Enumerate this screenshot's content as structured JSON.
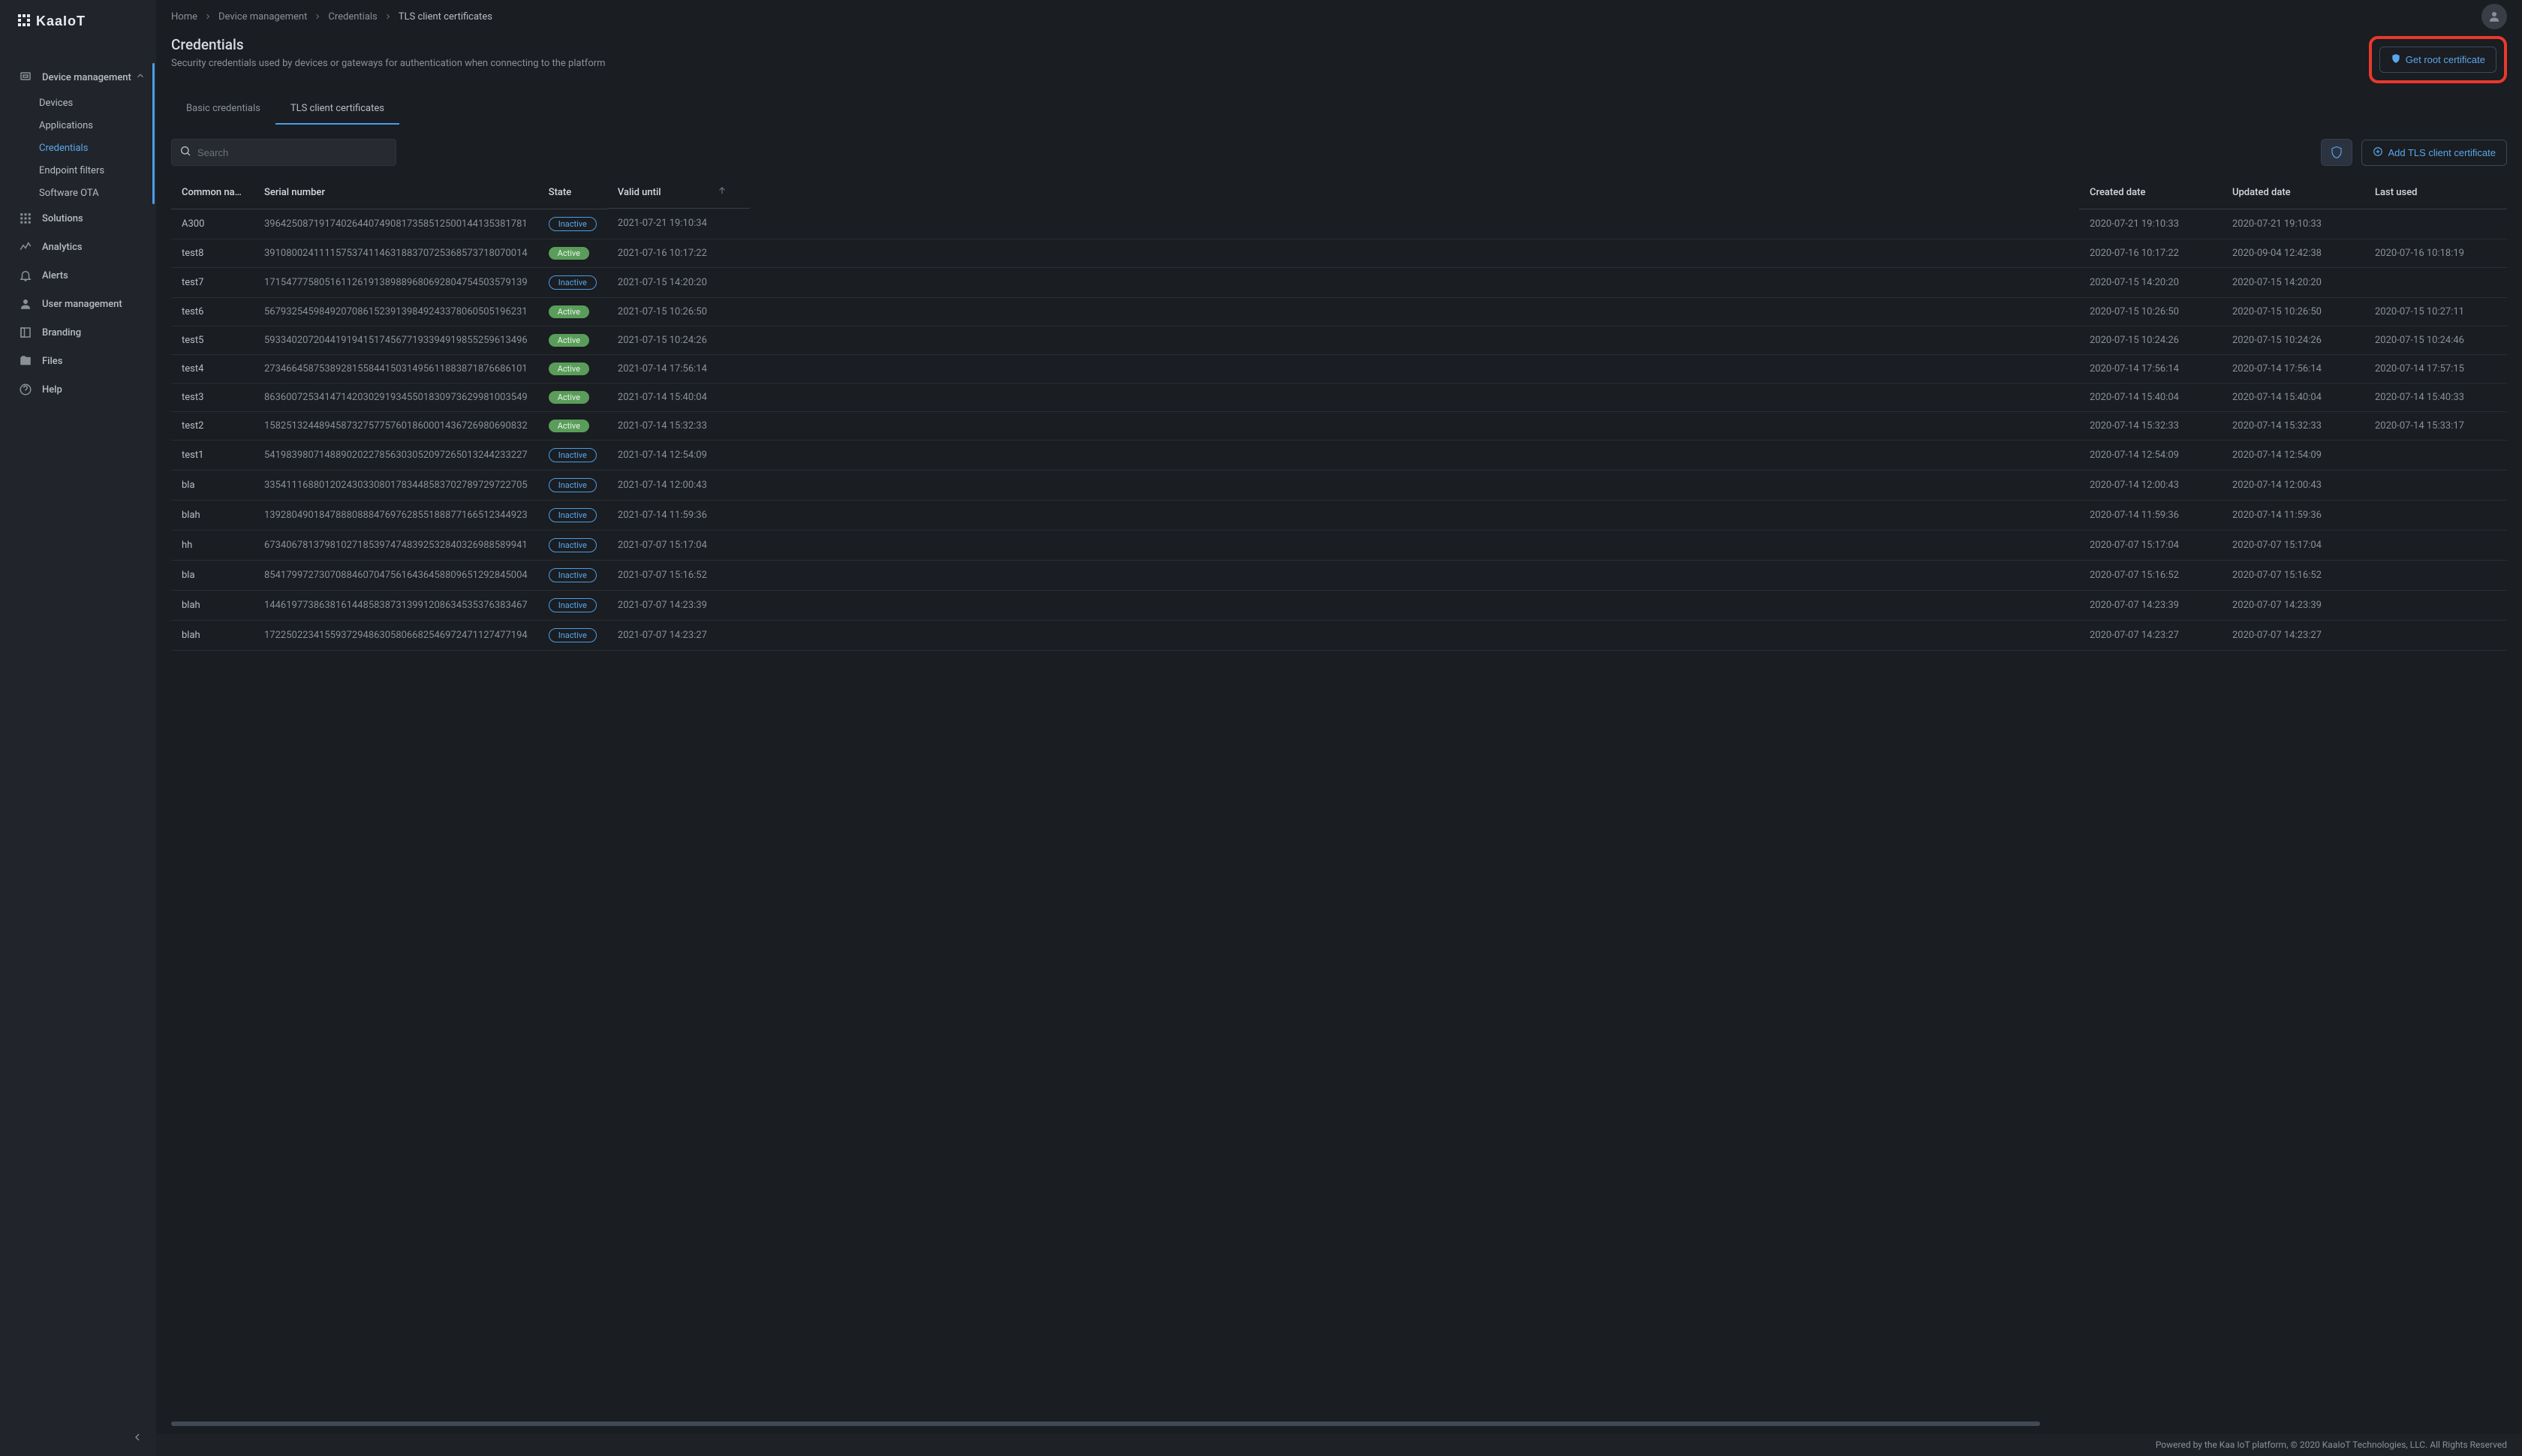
{
  "logo_text": "kaaIoT",
  "sidebar": {
    "items": [
      {
        "label": "Device management",
        "expanded": true,
        "children": [
          {
            "label": "Devices"
          },
          {
            "label": "Applications"
          },
          {
            "label": "Credentials",
            "active": true
          },
          {
            "label": "Endpoint filters"
          },
          {
            "label": "Software OTA"
          }
        ]
      },
      {
        "label": "Solutions"
      },
      {
        "label": "Analytics"
      },
      {
        "label": "Alerts"
      },
      {
        "label": "User management"
      },
      {
        "label": "Branding"
      },
      {
        "label": "Files"
      },
      {
        "label": "Help"
      }
    ]
  },
  "breadcrumb": [
    "Home",
    "Device management",
    "Credentials",
    "TLS client certificates"
  ],
  "page": {
    "title": "Credentials",
    "subtitle": "Security credentials used by devices or gateways for authentication when connecting to the platform",
    "get_root_label": "Get root certificate"
  },
  "tabs": {
    "basic": "Basic credentials",
    "tls": "TLS client certificates",
    "active": "tls"
  },
  "search": {
    "placeholder": "Search"
  },
  "toolbar": {
    "add_tls_label": "Add TLS client certificate"
  },
  "columns": {
    "common_name": "Common na…",
    "serial": "Serial number",
    "state": "State",
    "valid": "Valid until",
    "created": "Created date",
    "updated": "Updated date",
    "last_used": "Last used"
  },
  "rows": [
    {
      "common": "A300",
      "serial": "396425087191740264407490817358512500144135381781",
      "state": "Inactive",
      "valid": "2021-07-21 19:10:34",
      "created": "2020-07-21 19:10:33",
      "updated": "2020-07-21 19:10:33",
      "last": ""
    },
    {
      "common": "test8",
      "serial": "391080024111157537411463188370725368573718070014",
      "state": "Active",
      "valid": "2021-07-16 10:17:22",
      "created": "2020-07-16 10:17:22",
      "updated": "2020-09-04 12:42:38",
      "last": "2020-07-16 10:18:19"
    },
    {
      "common": "test7",
      "serial": "171547775805161126191389889680692804754503579139",
      "state": "Inactive",
      "valid": "2021-07-15 14:20:20",
      "created": "2020-07-15 14:20:20",
      "updated": "2020-07-15 14:20:20",
      "last": ""
    },
    {
      "common": "test6",
      "serial": "567932545984920708615239139849243378060505196231",
      "state": "Active",
      "valid": "2021-07-15 10:26:50",
      "created": "2020-07-15 10:26:50",
      "updated": "2020-07-15 10:26:50",
      "last": "2020-07-15 10:27:11"
    },
    {
      "common": "test5",
      "serial": "593340207204419194151745677193394919855259613496",
      "state": "Active",
      "valid": "2021-07-15 10:24:26",
      "created": "2020-07-15 10:24:26",
      "updated": "2020-07-15 10:24:26",
      "last": "2020-07-15 10:24:46"
    },
    {
      "common": "test4",
      "serial": "273466458753892815584415031495611883871876686101",
      "state": "Active",
      "valid": "2021-07-14 17:56:14",
      "created": "2020-07-14 17:56:14",
      "updated": "2020-07-14 17:56:14",
      "last": "2020-07-14 17:57:15"
    },
    {
      "common": "test3",
      "serial": "863600725341471420302919345501830973629981003549",
      "state": "Active",
      "valid": "2021-07-14 15:40:04",
      "created": "2020-07-14 15:40:04",
      "updated": "2020-07-14 15:40:04",
      "last": "2020-07-14 15:40:33"
    },
    {
      "common": "test2",
      "serial": "158251324489458732757757601860001436726980690832",
      "state": "Active",
      "valid": "2021-07-14 15:32:33",
      "created": "2020-07-14 15:32:33",
      "updated": "2020-07-14 15:32:33",
      "last": "2020-07-14 15:33:17"
    },
    {
      "common": "test1",
      "serial": "541983980714889020227856303052097265013244233227",
      "state": "Inactive",
      "valid": "2021-07-14 12:54:09",
      "created": "2020-07-14 12:54:09",
      "updated": "2020-07-14 12:54:09",
      "last": ""
    },
    {
      "common": "bla",
      "serial": "335411168801202430330801783448583702789729722705",
      "state": "Inactive",
      "valid": "2021-07-14 12:00:43",
      "created": "2020-07-14 12:00:43",
      "updated": "2020-07-14 12:00:43",
      "last": ""
    },
    {
      "common": "blah",
      "serial": "139280490184788808884769762855188877166512344923",
      "state": "Inactive",
      "valid": "2021-07-14 11:59:36",
      "created": "2020-07-14 11:59:36",
      "updated": "2020-07-14 11:59:36",
      "last": ""
    },
    {
      "common": "hh",
      "serial": "673406781379810271853974748392532840326988589941",
      "state": "Inactive",
      "valid": "2021-07-07 15:17:04",
      "created": "2020-07-07 15:17:04",
      "updated": "2020-07-07 15:17:04",
      "last": ""
    },
    {
      "common": "bla",
      "serial": "854179972730708846070475616436458809651292845004",
      "state": "Inactive",
      "valid": "2021-07-07 15:16:52",
      "created": "2020-07-07 15:16:52",
      "updated": "2020-07-07 15:16:52",
      "last": ""
    },
    {
      "common": "blah",
      "serial": "144619773863816144858387313991208634535376383467",
      "state": "Inactive",
      "valid": "2021-07-07 14:23:39",
      "created": "2020-07-07 14:23:39",
      "updated": "2020-07-07 14:23:39",
      "last": ""
    },
    {
      "common": "blah",
      "serial": "172250223415593729486305806682546972471127477194",
      "state": "Inactive",
      "valid": "2021-07-07 14:23:27",
      "created": "2020-07-07 14:23:27",
      "updated": "2020-07-07 14:23:27",
      "last": ""
    }
  ],
  "badge_labels": {
    "Active": "Active",
    "Inactive": "Inactive"
  },
  "footer": "Powered by the Kaa IoT platform, © 2020 KaaIoT Technologies, LLC. All Rights Reserved"
}
